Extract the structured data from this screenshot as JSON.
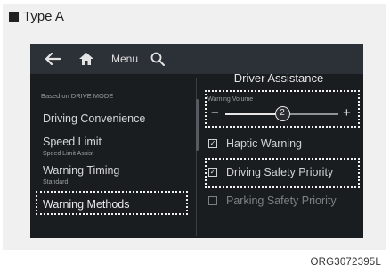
{
  "section": {
    "type_label": "Type A"
  },
  "topbar": {
    "back_icon": "back-arrow-icon",
    "home_icon": "home-icon",
    "menu_label": "Menu",
    "search_icon": "search-icon"
  },
  "panel": {
    "title": "Driver Assistance"
  },
  "left_menu": {
    "mode_caption": "Based on DRIVE MODE",
    "items": [
      {
        "label": "Driving Convenience",
        "sub": ""
      },
      {
        "label": "Speed Limit",
        "sub": "Speed Limit Assist"
      },
      {
        "label": "Warning Timing",
        "sub": "Standard"
      },
      {
        "label": "Warning Methods",
        "sub": ""
      }
    ]
  },
  "volume": {
    "caption": "Warning Volume",
    "minus_label": "−",
    "plus_label": "+",
    "value": "2",
    "level_fraction": 0.5
  },
  "options": [
    {
      "label": "Haptic Warning",
      "checked": true,
      "enabled": true
    },
    {
      "label": "Driving Safety Priority",
      "checked": true,
      "enabled": true
    },
    {
      "label": "Parking Safety Priority",
      "checked": false,
      "enabled": false
    }
  ],
  "check_glyph": "☑",
  "footer": {
    "code": "ORG3072395L"
  },
  "colors": {
    "screen_bg": "#1a1d20",
    "topbar_bg": "#2c3137",
    "highlight_border": "#f2f2f2"
  }
}
